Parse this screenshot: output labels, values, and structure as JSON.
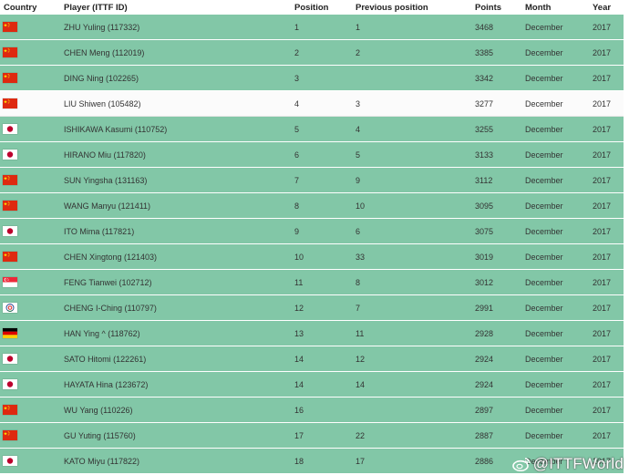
{
  "headers": {
    "country": "Country",
    "player": "Player (ITTF ID)",
    "position": "Position",
    "previous_position": "Previous position",
    "points": "Points",
    "month": "Month",
    "year": "Year"
  },
  "rows": [
    {
      "flag": "cn",
      "player": "ZHU Yuling (117332)",
      "position": "1",
      "previous": "1",
      "points": "3468",
      "month": "December",
      "year": "2017"
    },
    {
      "flag": "cn",
      "player": "CHEN Meng (112019)",
      "position": "2",
      "previous": "2",
      "points": "3385",
      "month": "December",
      "year": "2017"
    },
    {
      "flag": "cn",
      "player": "DING Ning (102265)",
      "position": "3",
      "previous": "",
      "points": "3342",
      "month": "December",
      "year": "2017"
    },
    {
      "flag": "cn",
      "player": "LIU Shiwen (105482)",
      "position": "4",
      "previous": "3",
      "points": "3277",
      "month": "December",
      "year": "2017",
      "highlight": true
    },
    {
      "flag": "jp",
      "player": "ISHIKAWA Kasumi (110752)",
      "position": "5",
      "previous": "4",
      "points": "3255",
      "month": "December",
      "year": "2017"
    },
    {
      "flag": "jp",
      "player": "HIRANO Miu (117820)",
      "position": "6",
      "previous": "5",
      "points": "3133",
      "month": "December",
      "year": "2017"
    },
    {
      "flag": "cn",
      "player": "SUN Yingsha (131163)",
      "position": "7",
      "previous": "9",
      "points": "3112",
      "month": "December",
      "year": "2017"
    },
    {
      "flag": "cn",
      "player": "WANG Manyu (121411)",
      "position": "8",
      "previous": "10",
      "points": "3095",
      "month": "December",
      "year": "2017"
    },
    {
      "flag": "jp",
      "player": "ITO Mima (117821)",
      "position": "9",
      "previous": "6",
      "points": "3075",
      "month": "December",
      "year": "2017"
    },
    {
      "flag": "cn",
      "player": "CHEN Xingtong (121403)",
      "position": "10",
      "previous": "33",
      "points": "3019",
      "month": "December",
      "year": "2017"
    },
    {
      "flag": "sg",
      "player": "FENG Tianwei (102712)",
      "position": "11",
      "previous": "8",
      "points": "3012",
      "month": "December",
      "year": "2017"
    },
    {
      "flag": "tpe",
      "player": "CHENG I-Ching (110797)",
      "position": "12",
      "previous": "7",
      "points": "2991",
      "month": "December",
      "year": "2017"
    },
    {
      "flag": "de",
      "player": "HAN Ying ^ (118762)",
      "position": "13",
      "previous": "11",
      "points": "2928",
      "month": "December",
      "year": "2017"
    },
    {
      "flag": "jp",
      "player": "SATO Hitomi (122261)",
      "position": "14",
      "previous": "12",
      "points": "2924",
      "month": "December",
      "year": "2017"
    },
    {
      "flag": "jp",
      "player": "HAYATA Hina (123672)",
      "position": "14",
      "previous": "14",
      "points": "2924",
      "month": "December",
      "year": "2017"
    },
    {
      "flag": "cn",
      "player": "WU Yang (110226)",
      "position": "16",
      "previous": "",
      "points": "2897",
      "month": "December",
      "year": "2017"
    },
    {
      "flag": "cn",
      "player": "GU Yuting (115760)",
      "position": "17",
      "previous": "22",
      "points": "2887",
      "month": "December",
      "year": "2017"
    },
    {
      "flag": "jp",
      "player": "KATO Miyu (117822)",
      "position": "18",
      "previous": "17",
      "points": "2886",
      "month": "December",
      "year": "2017"
    }
  ],
  "watermark": "@ITTFWorld",
  "colors": {
    "row_bg": "#82c7a7",
    "highlight_bg": "#fbfbfb"
  }
}
